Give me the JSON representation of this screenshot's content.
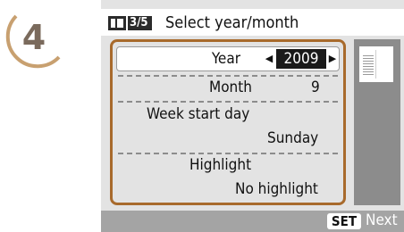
{
  "step": {
    "number": "4"
  },
  "header": {
    "icon": "printer-layout-icon",
    "page_indicator": "3/5",
    "title": "Select year/month"
  },
  "settings": {
    "year": {
      "label": "Year",
      "value": "2009",
      "left_arrow": "◀",
      "right_arrow": "▶"
    },
    "month": {
      "label": "Month",
      "value": "9"
    },
    "week_start_day": {
      "label": "Week start day",
      "value": "Sunday"
    },
    "highlight": {
      "label": "Highlight",
      "value": "No highlight"
    }
  },
  "preview": {
    "icon": "calendar-thumbnail-icon"
  },
  "footer": {
    "set_label": "SET",
    "next_label": "Next"
  },
  "colors": {
    "panel_border": "#a86a2c",
    "step_badge": "#c8a070",
    "screen_bg": "#e3e3e3"
  }
}
